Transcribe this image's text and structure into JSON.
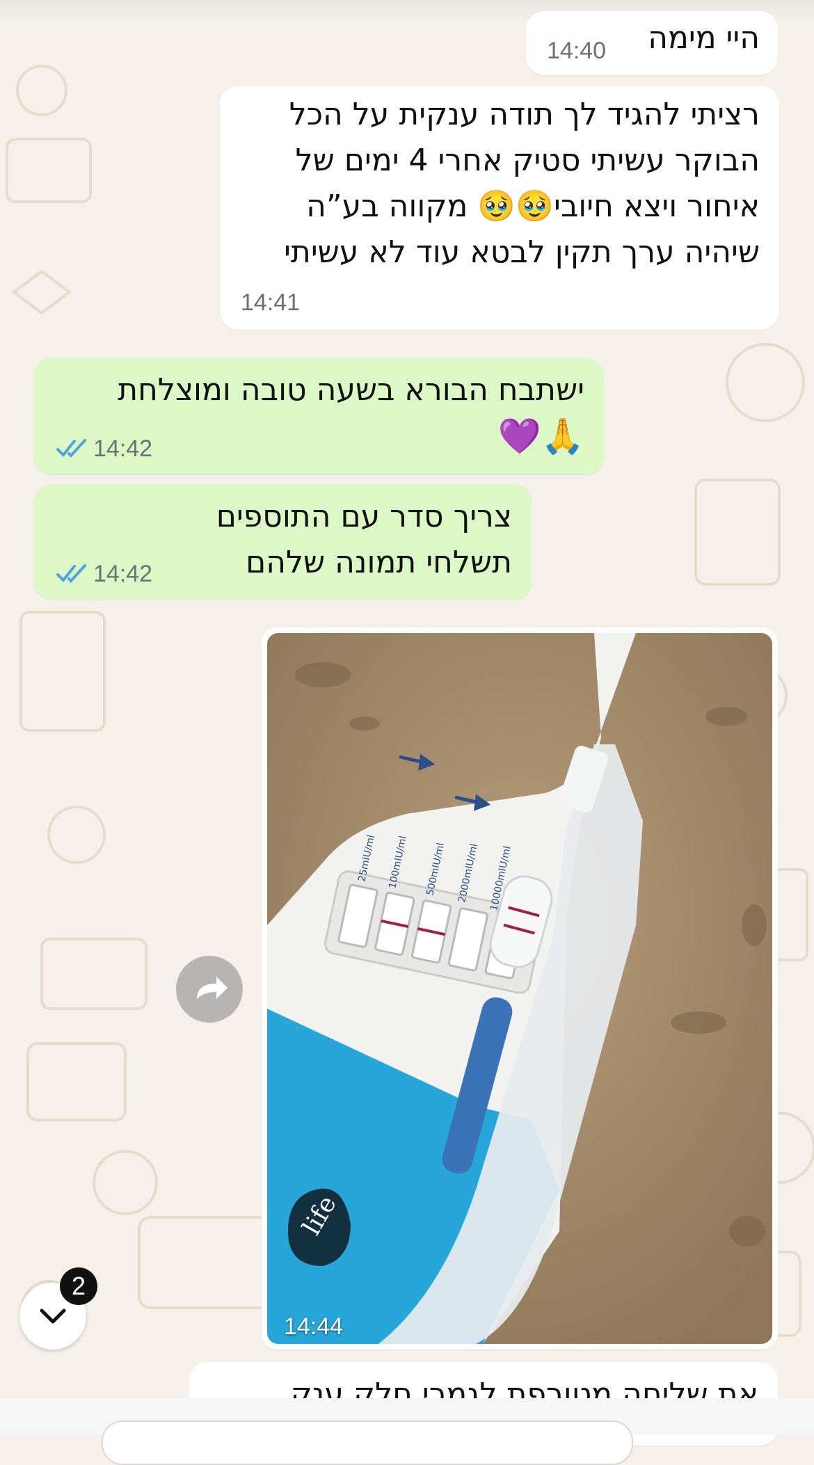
{
  "messages": [
    {
      "lines": [
        "היי מימה"
      ],
      "time": "14:40"
    },
    {
      "lines": [
        "רציתי להגיד לך תודה ענקית על הכל",
        "הבוקר עשיתי סטיק אחרי 4 ימים של",
        "איחור ויצא חיובי🥹🥹 מקווה בע”ה",
        "שיהיה ערך תקין לבטא עוד לא עשיתי"
      ],
      "time": "14:41"
    },
    {
      "lines": [
        "ישתבח הבורא בשעה טובה ומוצלחת",
        "🙏💜"
      ],
      "time": "14:42"
    },
    {
      "lines": [
        "צריך סדר עם התוספים",
        "תשלחי תמונה שלהם"
      ],
      "time": "14:42"
    },
    {
      "lines": [
        "את שליחה מטורפת לגמרי חלק ענק"
      ]
    }
  ],
  "photo_message": {
    "time": "14:44",
    "test_labels": [
      "25mIU/ml",
      "100mIU/ml",
      "500mIU/ml",
      "2000mIU/ml",
      "10000mIU/ml"
    ],
    "brand": "life"
  },
  "scroll_button": {
    "unread_count": "2"
  },
  "colors": {
    "incoming": "#ffffff",
    "outgoing": "#dcf8c6",
    "read_ticks": "#4fa3e0",
    "background": "#f5f1ea"
  }
}
